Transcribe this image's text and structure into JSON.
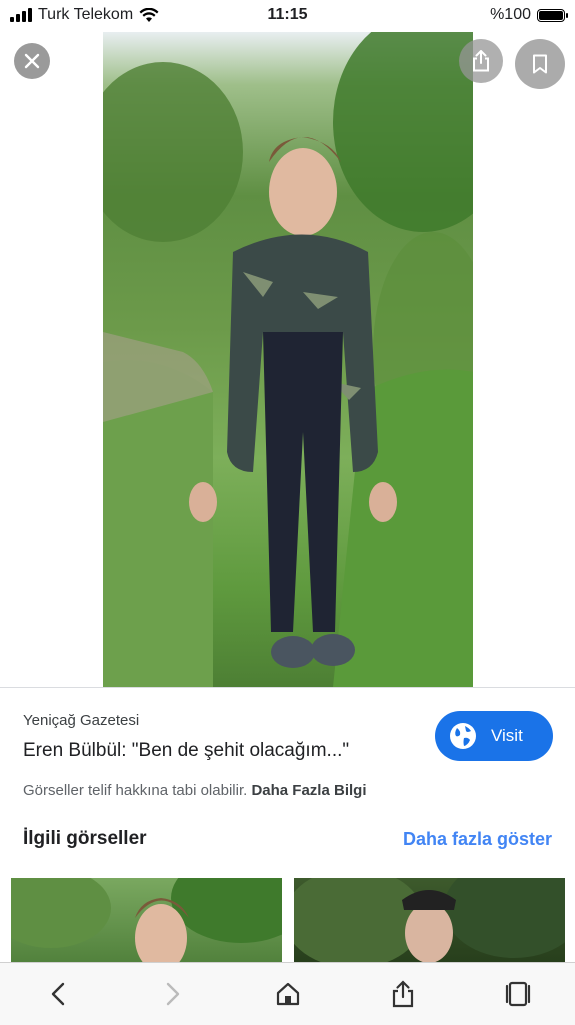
{
  "status": {
    "carrier": "Turk Telekom",
    "time": "11:15",
    "battery": "%100"
  },
  "result": {
    "source": "Yeniçağ Gazetesi",
    "caption": "Eren Bülbül: \"Ben de şehit olacağım...\"",
    "visit_label": "Visit",
    "copyright_text": "Görseller telif hakkına tabi olabilir.",
    "more_info_link": "Daha Fazla Bilgi"
  },
  "related": {
    "title": "İlgili görseller",
    "show_more": "Daha fazla göster"
  },
  "colors": {
    "accent": "#1a73e8",
    "link": "#4285f4"
  },
  "icons": [
    "close-icon",
    "share-icon",
    "bookmark-icon",
    "globe-icon",
    "back-icon",
    "forward-icon",
    "home-icon",
    "share-icon",
    "tabs-icon"
  ]
}
